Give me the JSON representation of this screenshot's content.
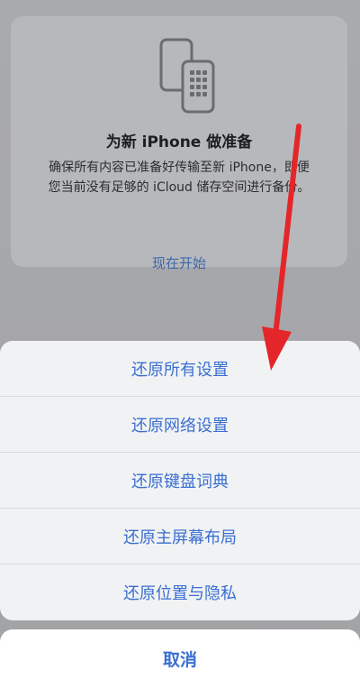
{
  "prepare_card": {
    "icon": "two-phones-icon",
    "title": "为新 iPhone 做准备",
    "description": "确保所有内容已准备好传输至新 iPhone，即便\n您当前没有足够的 iCloud 储存空间进行备份。",
    "action_label": "现在开始"
  },
  "action_sheet": {
    "items": [
      {
        "label": "还原所有设置"
      },
      {
        "label": "还原网络设置"
      },
      {
        "label": "还原键盘词典"
      },
      {
        "label": "还原主屏幕布局"
      },
      {
        "label": "还原位置与隐私"
      }
    ],
    "cancel_label": "取消"
  },
  "annotation": {
    "icon": "red-arrow-icon",
    "color": "#e4262a"
  },
  "colors": {
    "accent": "#3a6fd1",
    "sheet_bg": "#f1f2f4",
    "dim_bg": "#a7a8ab"
  }
}
